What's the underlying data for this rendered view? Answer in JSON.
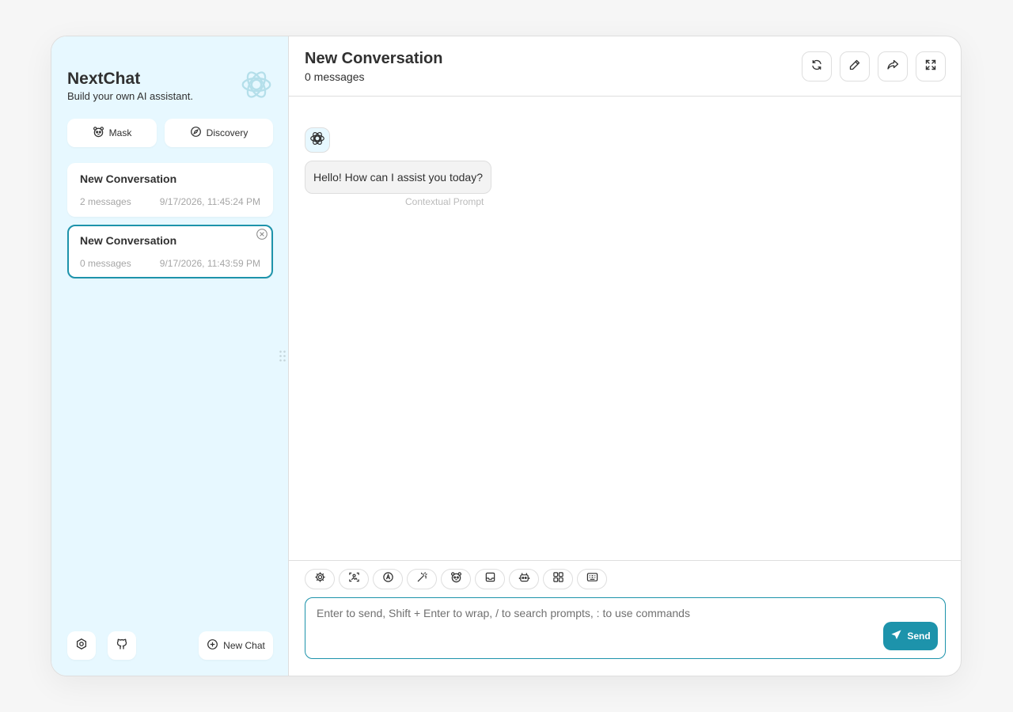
{
  "colors": {
    "accent": "#1d93ab",
    "sidebar_bg": "#e7f8ff",
    "bubble_bg": "#f3f3f3",
    "border": "#dedede"
  },
  "sidebar": {
    "title": "NextChat",
    "subtitle": "Build your own AI assistant.",
    "logo_icon": "openai-logo-icon",
    "mask_label": "Mask",
    "discovery_label": "Discovery",
    "chats": [
      {
        "title": "New Conversation",
        "count": "2 messages",
        "date": "9/17/2026, 11:45:24 PM",
        "selected": false
      },
      {
        "title": "New Conversation",
        "count": "0 messages",
        "date": "9/17/2026, 11:43:59 PM",
        "selected": true
      }
    ],
    "new_chat_label": "New Chat",
    "bottom_icons": [
      "settings-icon",
      "github-icon"
    ]
  },
  "header": {
    "title": "New Conversation",
    "subtitle": "0 messages",
    "buttons": [
      "refresh-icon",
      "edit-icon",
      "share-icon",
      "fullscreen-icon"
    ]
  },
  "messages": [
    {
      "role": "assistant",
      "text": "Hello! How can I assist you today?",
      "label": "Contextual Prompt"
    }
  ],
  "input": {
    "placeholder": "Enter to send, Shift + Enter to wrap, / to search prompts, : to use commands",
    "value": "",
    "send_label": "Send",
    "actions": [
      "settings-icon",
      "image-icon",
      "theme-icon",
      "prompt-icon",
      "mask-icon",
      "clear-context-icon",
      "robot-icon",
      "plugin-icon",
      "shortcut-icon"
    ]
  }
}
